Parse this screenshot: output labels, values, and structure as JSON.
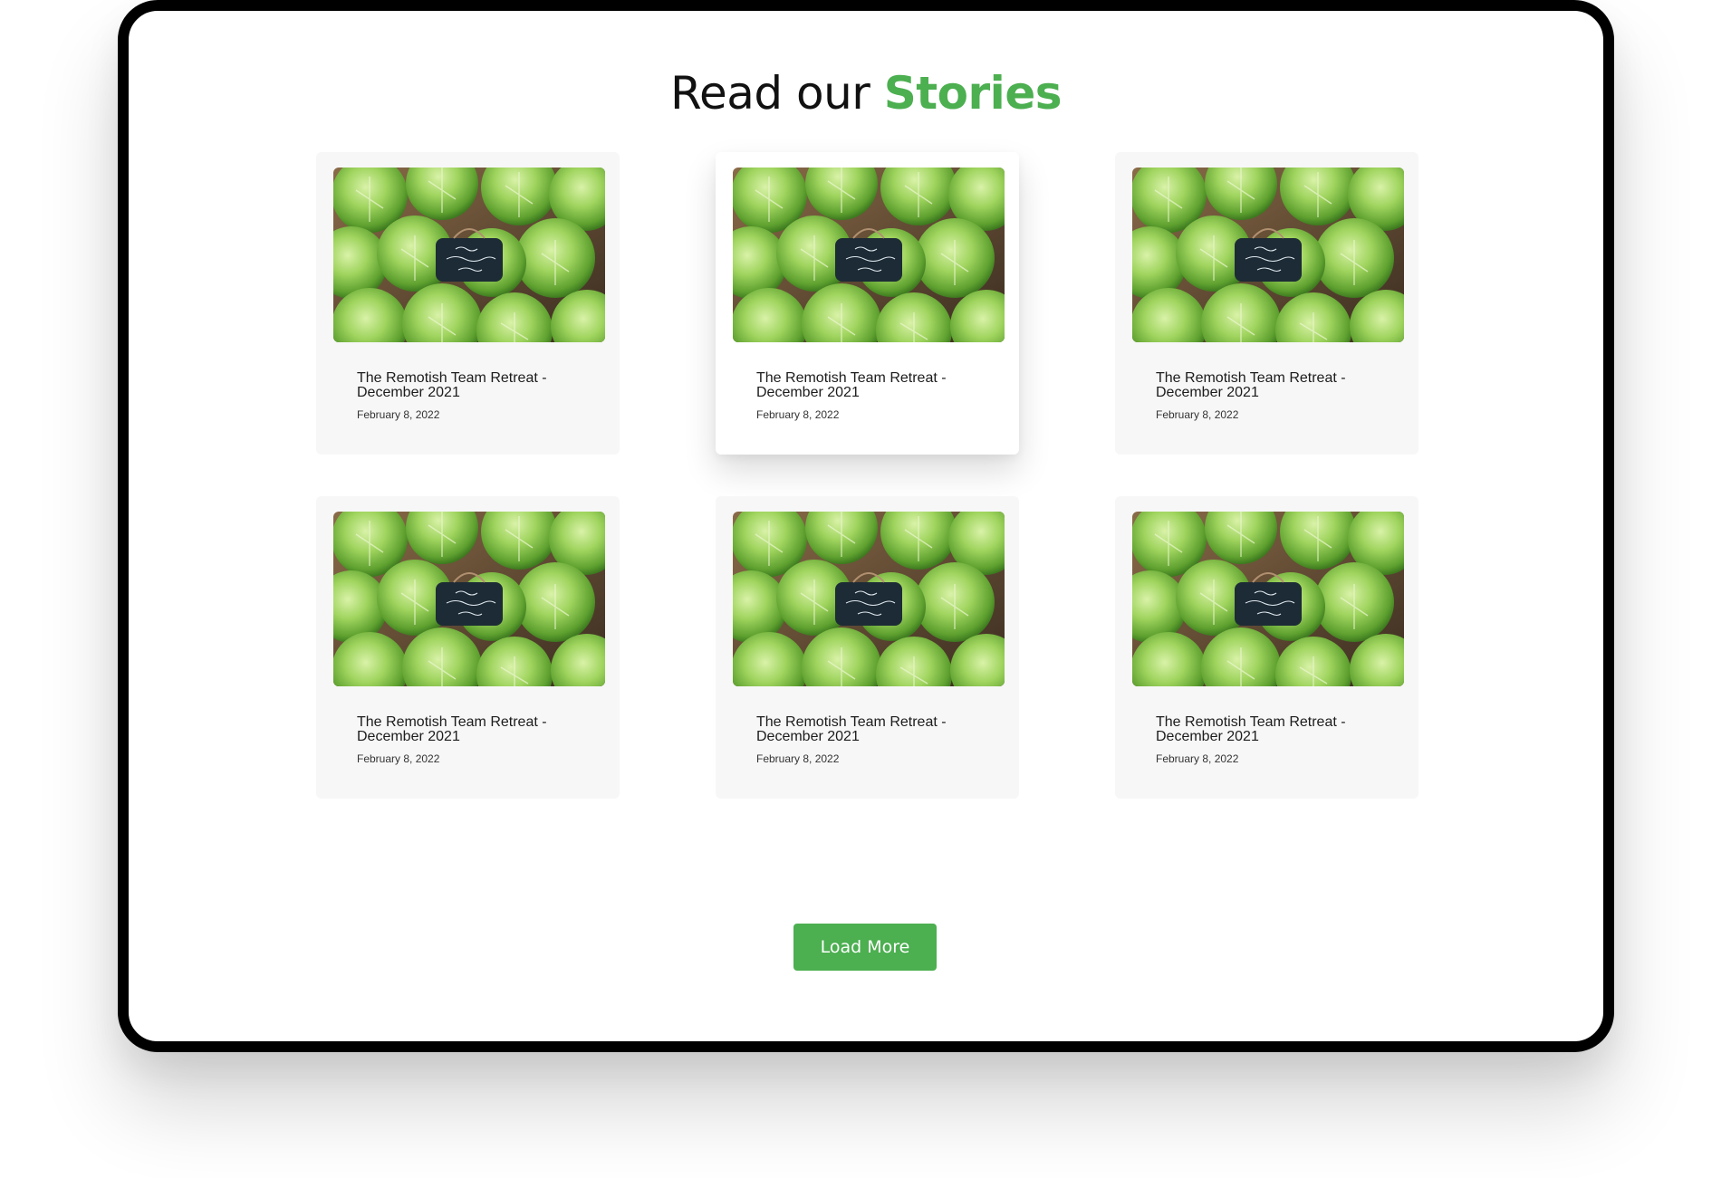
{
  "heading": {
    "prefix": "Read our",
    "accent": "Stories"
  },
  "colors": {
    "accent": "#4caf50",
    "card_bg": "#f7f7f7",
    "frame": "#000000"
  },
  "stories": [
    {
      "title": "The Remotish Team Retreat - December 2021",
      "date": "February 8, 2022",
      "image": "cabbage-photo"
    },
    {
      "title": "The Remotish Team Retreat - December 2021",
      "date": "February 8, 2022",
      "image": "cabbage-photo"
    },
    {
      "title": "The Remotish Team Retreat - December 2021",
      "date": "February 8, 2022",
      "image": "cabbage-photo"
    },
    {
      "title": "The Remotish Team Retreat - December 2021",
      "date": "February 8, 2022",
      "image": "cabbage-photo"
    },
    {
      "title": "The Remotish Team Retreat - December 2021",
      "date": "February 8, 2022",
      "image": "cabbage-photo"
    },
    {
      "title": "The Remotish Team Retreat - December 2021",
      "date": "February 8, 2022",
      "image": "cabbage-photo"
    }
  ],
  "load_more_label": "Load More"
}
